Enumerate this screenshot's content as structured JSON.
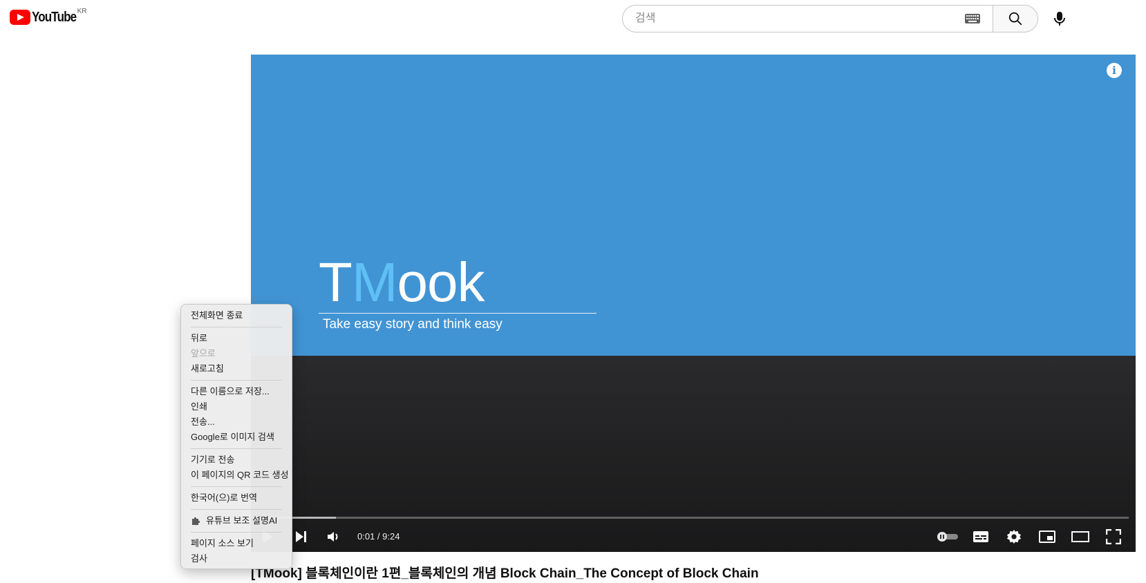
{
  "header": {
    "logo_text": "YouTube",
    "logo_country": "KR",
    "search_placeholder": "검색"
  },
  "player": {
    "brand_t": "T",
    "brand_m": "M",
    "brand_rest": "ook",
    "tagline": "Take easy story and think easy",
    "info_symbol": "i",
    "time": "0:01 / 9:24",
    "progress_fraction": 0.0018,
    "buffer_fraction": 0.09
  },
  "video_title": "[TMook] 블록체인이란 1편_블록체인의 개념 Block Chain_The Concept of Block Chain",
  "context_menu": {
    "exit_fullscreen": "전체화면 종료",
    "back": "뒤로",
    "forward": "앞으로",
    "reload": "새로고침",
    "save_as": "다른 이름으로 저장...",
    "print": "인쇄",
    "send": "전송...",
    "google_image_search": "Google로 이미지 검색",
    "send_to_device": "기기로 전송",
    "qr_code": "이 페이지의 QR 코드 생성",
    "translate": "한국어(으)로 번역",
    "extension": "유튜브 보조 설명AI",
    "view_source": "페이지 소스 보기",
    "inspect": "검사"
  },
  "colors": {
    "youtube_red": "#ff0000",
    "video_blue": "#4194d4",
    "brand_m_blue": "#5fc0f5"
  }
}
